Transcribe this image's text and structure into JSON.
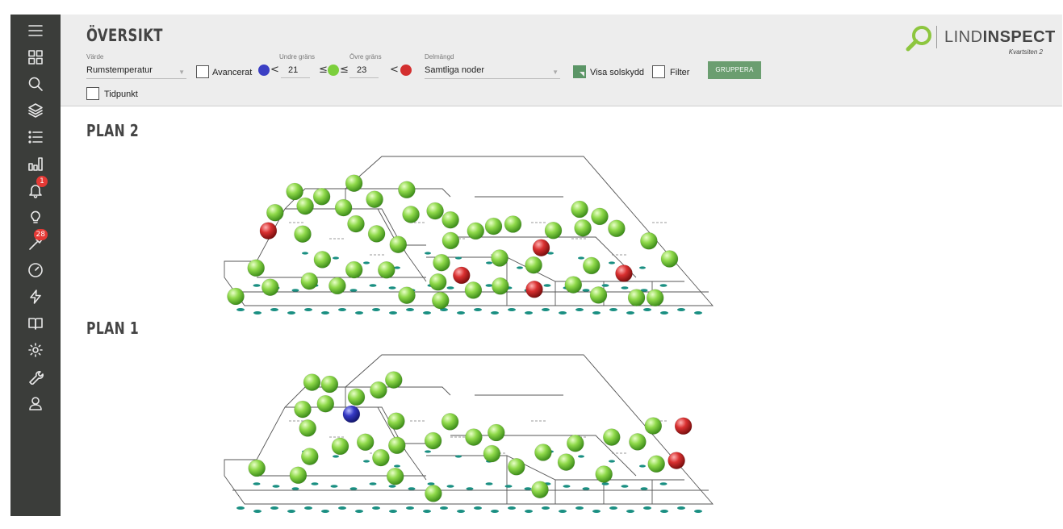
{
  "app": {
    "page_title": "ÖVERSIKT",
    "logo": {
      "brand_light": "LIND",
      "brand_bold": "INSPECT",
      "site": "Kvartsiten 2"
    }
  },
  "sidebar": {
    "items": [
      {
        "icon": "menu-icon"
      },
      {
        "icon": "dashboard-grid-icon"
      },
      {
        "icon": "search-icon"
      },
      {
        "icon": "layers-icon"
      },
      {
        "icon": "list-icon"
      },
      {
        "icon": "bar-chart-icon"
      },
      {
        "icon": "bell-icon",
        "badge": "1"
      },
      {
        "icon": "lightbulb-icon"
      },
      {
        "icon": "tools-icon",
        "badge": "28"
      },
      {
        "icon": "gauge-icon"
      },
      {
        "icon": "lightning-icon"
      },
      {
        "icon": "book-icon"
      },
      {
        "icon": "settings-icon"
      },
      {
        "icon": "wrench-icon"
      },
      {
        "icon": "user-icon"
      }
    ]
  },
  "filters": {
    "value_label": "Värde",
    "value_selected": "Rumstemperatur",
    "advanced_label": "Avancerat",
    "lower_label": "Undre gräns",
    "lower_value": "21",
    "upper_label": "Övre gräns",
    "upper_value": "23",
    "lt_symbol": "<",
    "le_symbol": "≤",
    "subset_label": "Delmängd",
    "subset_selected": "Samtliga noder",
    "sunshade_label": "Visa solskydd",
    "filter_label": "Filter",
    "group_button": "GRUPPERA",
    "timepoint_label": "Tidpunkt",
    "colors": {
      "below": "#3b3fc4",
      "within": "#7ccf3c",
      "above": "#d32f2f"
    }
  },
  "plans": [
    {
      "title": "PLAN 2",
      "sensors": {
        "within": 47,
        "above": 5,
        "below": 0
      }
    },
    {
      "title": "PLAN 1",
      "sensors": {
        "within": 33,
        "above": 2,
        "below": 1
      }
    }
  ]
}
